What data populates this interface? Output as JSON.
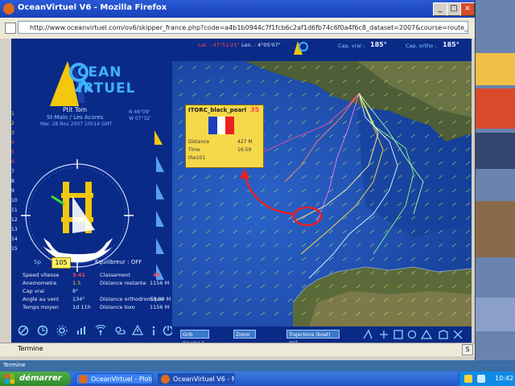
{
  "window": {
    "title": "OceanVirtuel V6 - Mozilla Firefox",
    "url": "http://www.oceanvirtuel.com/ov6/skipper_france.php?code=a4b1b0944c7f1fcb6c2af1d6fb74c6f0a4f6c8_dataset=2007&course=route_du_rhum+&+ol+44+pts=Cockpit&popup"
  },
  "panel": {
    "logo_line1": "CEAN",
    "logo_line2": "IRTUEL",
    "skipper_name": "Ptit Tom",
    "route": "St-Malo / Les Acores",
    "date": "Mer. 28 Nov 2007 10h14 GMT",
    "coords_a": "N 46°09'",
    "coords_b": "W 07°32'",
    "wind_speed": "105",
    "sail_label": "Equilibreur : OFF",
    "labels": {
      "speed": "Speed vitesse",
      "anemometer": "Anemometre",
      "cap": "Cap vrai",
      "angle": "Angle au vent",
      "time": "Temps moyen",
      "rank": "Classement",
      "distance": "Distance restante",
      "dist_orth": "Distance orthodromique",
      "dist_loxo": "Distance loxo"
    },
    "values": {
      "speed": "3.41",
      "anemometer": "1.5",
      "cap": "8°",
      "angle": "134°",
      "time": "1d 11h",
      "rank": "45",
      "distance": "1156 M",
      "dist_orth": "13.09 M",
      "dist_loxo": "1156 M"
    },
    "roman_numerals": [
      "1",
      "2",
      "3",
      "4",
      "5",
      "6",
      "7",
      "8",
      "9",
      "10",
      "11",
      "12",
      "13",
      "14",
      "15"
    ]
  },
  "top_info": {
    "lat_label": "Lat. : 47°51'21\"",
    "lon_label": "Lon. : 4°05'07\"",
    "cap_label": "Cap. vrai :",
    "cap_value": "185°",
    "cap2_label": "Cap. ortho :",
    "cap2_value": "185°"
  },
  "popup": {
    "boat_name": "ITORC_black_pearl",
    "rank": "35",
    "distance_label": "Distance",
    "distance_value": "427 M",
    "time_label": "Time",
    "time_value": "16:59",
    "extra_label": "the101"
  },
  "bottom_controls": {
    "select1": "Grib (Vents) 1",
    "select2": "Zoom",
    "select3": "Trajectoire (boat) OFF"
  },
  "status_bar": {
    "text": "Termine"
  },
  "desktop_strip": {
    "text": "Termine"
  },
  "taskbar": {
    "start": "démarrer",
    "tasks": [
      "OceanVirtuel - Plotolab...",
      "OceanVirtuel V6 - Mo..."
    ],
    "clock": "10:42"
  },
  "colors": {
    "panel_bg": "#0a2a88",
    "accent_yellow": "#ffd23a",
    "sea": "#1f4fb0",
    "land": "#5b6a3a"
  }
}
